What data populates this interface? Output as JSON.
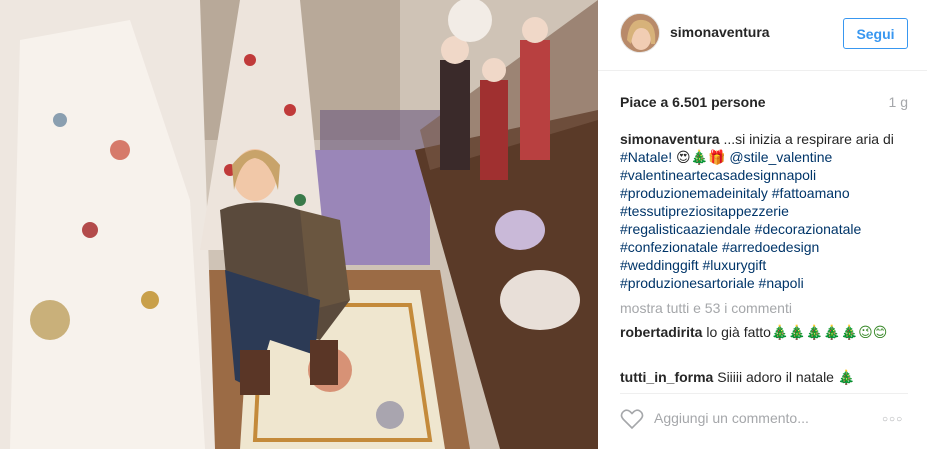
{
  "photo": {
    "alt_description_icon": "photo-christmas-shop"
  },
  "header": {
    "username": "simonaventura",
    "follow_label": "Segui"
  },
  "likes": {
    "text": "Piace a 6.501 persone",
    "time": "1 g"
  },
  "caption": {
    "username": "simonaventura",
    "text_start": " ...si inizia a respirare aria di ",
    "tag_natale": "#Natale!",
    "emojis": " 😍🎄🎁 ",
    "mention": "@stile_valentine",
    "tags": [
      "#valentineartecasadesignnapoli",
      "#produzionemadeinitaly",
      "#fattoamano",
      "#tessutipreziositappezzerie",
      "#regalisticaaziendale",
      "#decorazionatale",
      "#confezionatale",
      "#arredoedesign",
      "#weddinggift",
      "#luxurygift",
      "#produzionesartoriale",
      "#napoli"
    ]
  },
  "comments": {
    "view_all": "mostra tutti e 53 i commenti",
    "items": [
      {
        "user": "robertadirita",
        "text": "lo già fatto",
        "emojis": "🎄🎄🎄🎄🎄😉😊"
      },
      {
        "user": "tutti_in_forma",
        "text": "Siiiii adoro il natale",
        "emojis": "🎄"
      }
    ]
  },
  "footer": {
    "comment_placeholder": "Aggiungi un commento...",
    "more_label": "○○○"
  },
  "colors": {
    "follow_blue": "#3897f0",
    "hashtag_blue": "#003569",
    "muted_gray": "#a5a7aa"
  }
}
